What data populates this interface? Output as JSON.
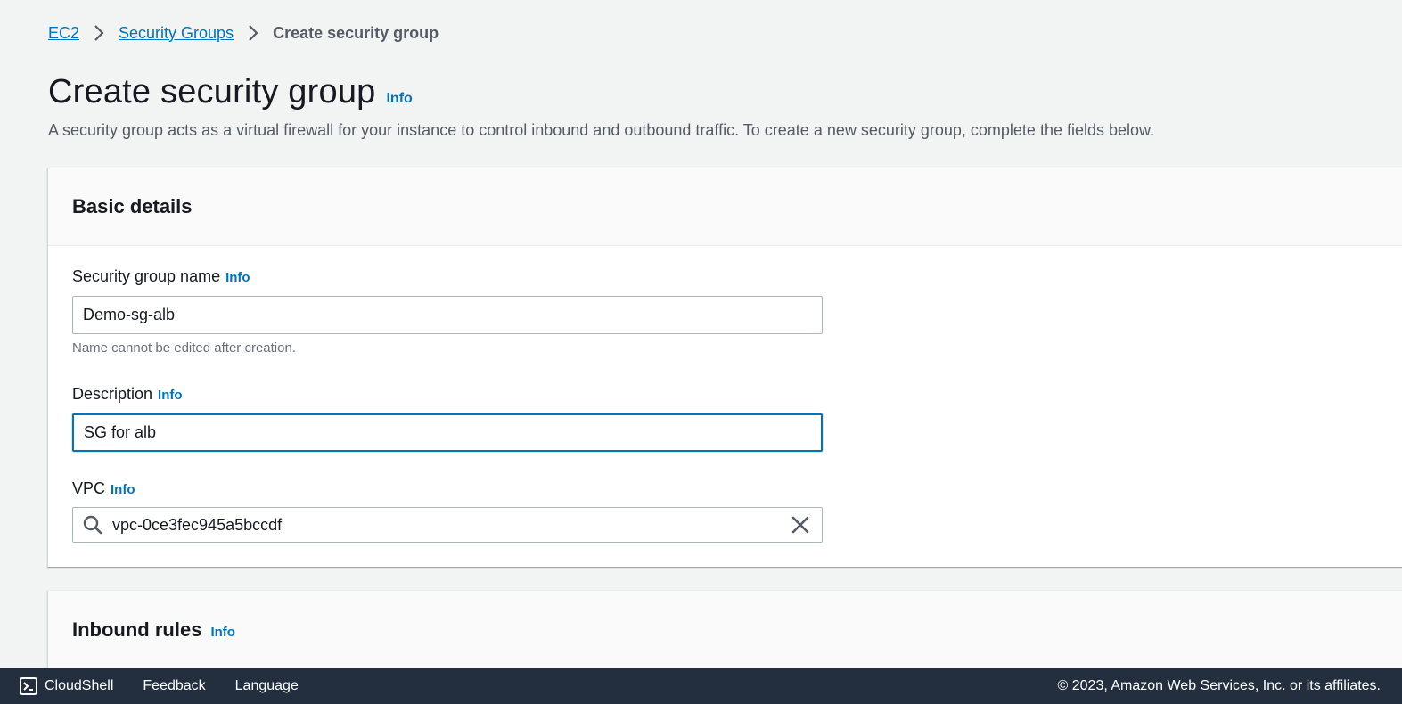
{
  "breadcrumb": {
    "items": [
      "EC2",
      "Security Groups"
    ],
    "current": "Create security group"
  },
  "page": {
    "title": "Create security group",
    "info": "Info",
    "description": "A security group acts as a virtual firewall for your instance to control inbound and outbound traffic. To create a new security group, complete the fields below."
  },
  "basic_details": {
    "title": "Basic details",
    "name": {
      "label": "Security group name",
      "info": "Info",
      "value": "Demo-sg-alb",
      "hint": "Name cannot be edited after creation."
    },
    "description": {
      "label": "Description",
      "info": "Info",
      "value": "SG for alb"
    },
    "vpc": {
      "label": "VPC",
      "info": "Info",
      "value": "vpc-0ce3fec945a5bccdf"
    }
  },
  "inbound_rules": {
    "title": "Inbound rules",
    "info": "Info"
  },
  "footer": {
    "cloudshell": "CloudShell",
    "feedback": "Feedback",
    "language": "Language",
    "copyright": "© 2023, Amazon Web Services, Inc. or its affiliates."
  },
  "colors": {
    "link": "#0073bb",
    "footer_bg": "#232f3e",
    "page_bg": "#f2f3f3"
  }
}
